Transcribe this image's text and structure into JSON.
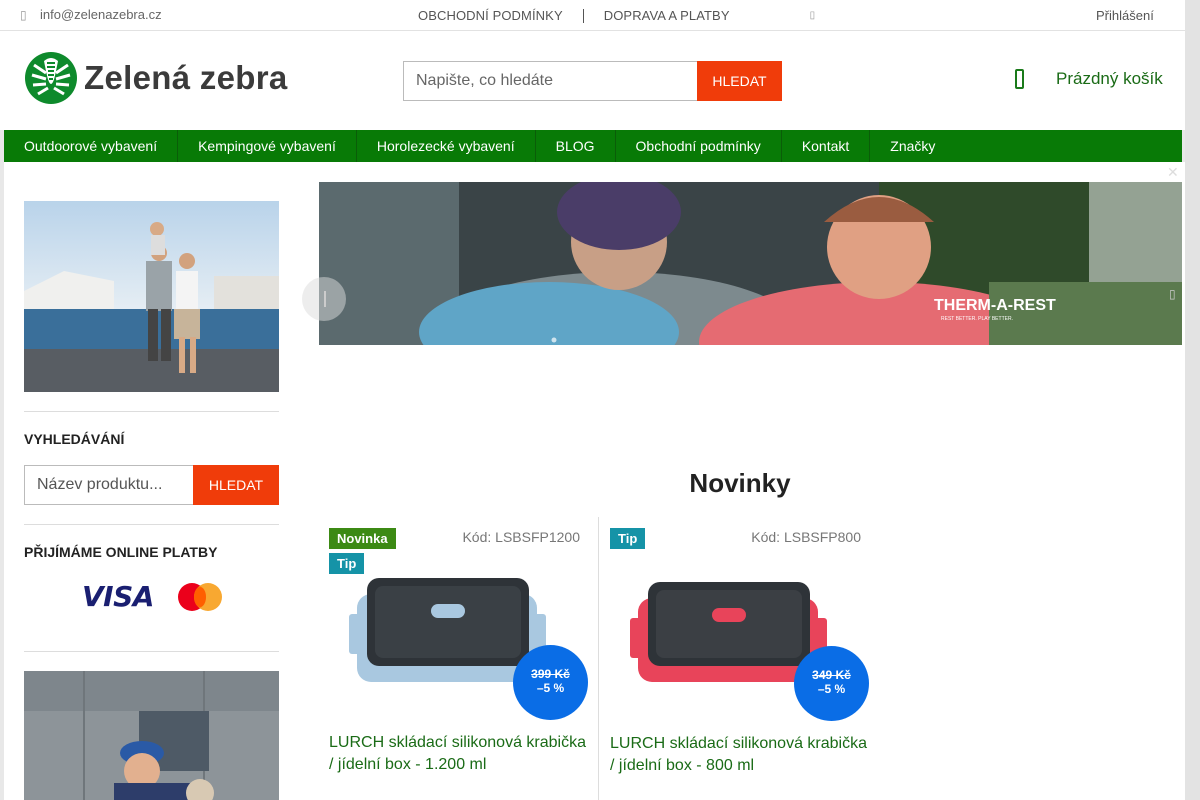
{
  "topbar": {
    "email": "info@zelenazebra.cz",
    "links": [
      "OBCHODNÍ PODMÍNKY",
      "DOPRAVA A PLATBY"
    ],
    "login": "Přihlášení"
  },
  "header": {
    "logo_text": "Zelená zebra",
    "search": {
      "placeholder": "Napište, co hledáte",
      "button": "HLEDAT"
    },
    "cart_label": "Prázdný košík"
  },
  "menu": {
    "items": [
      "Outdoorové vybavení",
      "Kempingové vybavení",
      "Horolezecké vybavení",
      "BLOG",
      "Obchodní podmínky",
      "Kontakt",
      "Značky"
    ]
  },
  "sidebar": {
    "search_title": "VYHLEDÁVÁNÍ",
    "search": {
      "placeholder": "Název produktu...",
      "button": "HLEDAT"
    },
    "payments_title": "PŘIJÍMÁME ONLINE PLATBY",
    "visa_text": "VISA"
  },
  "banner": {
    "brand": "THERM-A-REST",
    "tagline": "REST BETTER. PLAY BETTER."
  },
  "main": {
    "heading": "Novinky",
    "products": [
      {
        "badges": [
          "Novinka",
          "Tip"
        ],
        "code": "Kód: LSBSFP1200",
        "old_price": "399 Kč",
        "discount": "–5 %",
        "name": "LURCH skládací silikonová krabička / jídelní box - 1.200 ml",
        "color": "#a9c8e0"
      },
      {
        "badges": [
          "Tip"
        ],
        "code": "Kód: LSBSFP800",
        "old_price": "349 Kč",
        "discount": "–5 %",
        "name": "LURCH skládací silikonová krabička / jídelní box - 800 ml",
        "color": "#e8445a"
      }
    ]
  },
  "colors": {
    "brand_green": "#087a06",
    "accent_orange": "#f03c0a",
    "sale_blue": "#0a6de6"
  }
}
